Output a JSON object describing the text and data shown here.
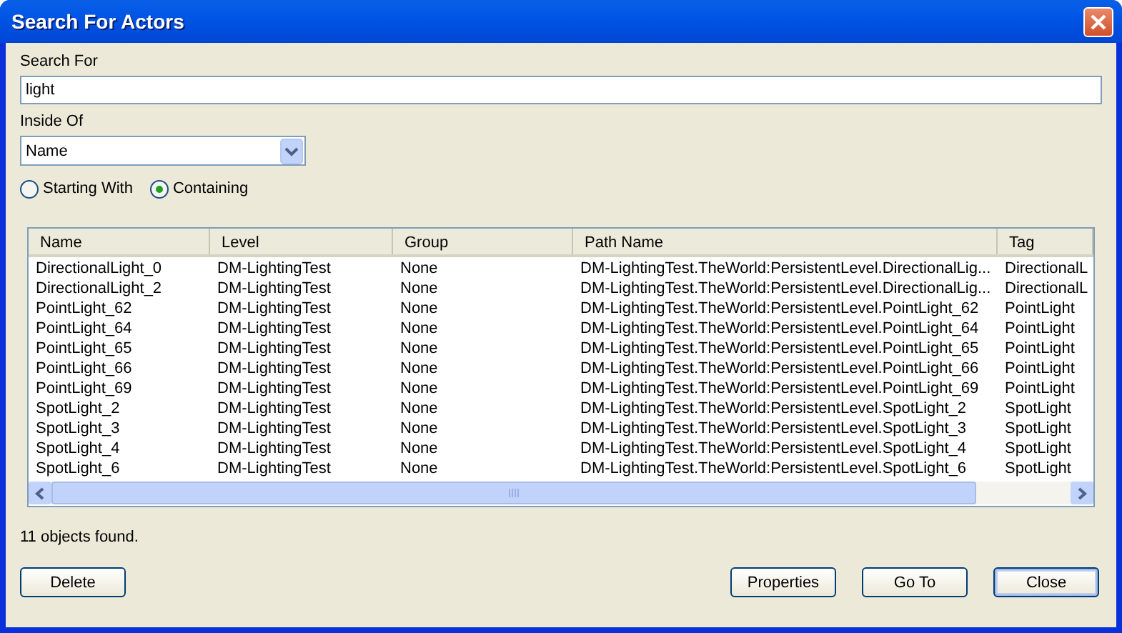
{
  "window": {
    "title": "Search For Actors"
  },
  "search_for": {
    "label": "Search For",
    "value": "light"
  },
  "inside_of": {
    "label": "Inside Of",
    "value": "Name"
  },
  "match_options": [
    {
      "label": "Starting With",
      "selected": false
    },
    {
      "label": "Containing",
      "selected": true
    }
  ],
  "table": {
    "columns": [
      "Name",
      "Level",
      "Group",
      "Path Name",
      "Tag"
    ],
    "rows": [
      [
        "DirectionalLight_0",
        "DM-LightingTest",
        "None",
        "DM-LightingTest.TheWorld:PersistentLevel.DirectionalLig...",
        "DirectionalL"
      ],
      [
        "DirectionalLight_2",
        "DM-LightingTest",
        "None",
        "DM-LightingTest.TheWorld:PersistentLevel.DirectionalLig...",
        "DirectionalL"
      ],
      [
        "PointLight_62",
        "DM-LightingTest",
        "None",
        "DM-LightingTest.TheWorld:PersistentLevel.PointLight_62",
        "PointLight"
      ],
      [
        "PointLight_64",
        "DM-LightingTest",
        "None",
        "DM-LightingTest.TheWorld:PersistentLevel.PointLight_64",
        "PointLight"
      ],
      [
        "PointLight_65",
        "DM-LightingTest",
        "None",
        "DM-LightingTest.TheWorld:PersistentLevel.PointLight_65",
        "PointLight"
      ],
      [
        "PointLight_66",
        "DM-LightingTest",
        "None",
        "DM-LightingTest.TheWorld:PersistentLevel.PointLight_66",
        "PointLight"
      ],
      [
        "PointLight_69",
        "DM-LightingTest",
        "None",
        "DM-LightingTest.TheWorld:PersistentLevel.PointLight_69",
        "PointLight"
      ],
      [
        "SpotLight_2",
        "DM-LightingTest",
        "None",
        "DM-LightingTest.TheWorld:PersistentLevel.SpotLight_2",
        "SpotLight"
      ],
      [
        "SpotLight_3",
        "DM-LightingTest",
        "None",
        "DM-LightingTest.TheWorld:PersistentLevel.SpotLight_3",
        "SpotLight"
      ],
      [
        "SpotLight_4",
        "DM-LightingTest",
        "None",
        "DM-LightingTest.TheWorld:PersistentLevel.SpotLight_4",
        "SpotLight"
      ],
      [
        "SpotLight_6",
        "DM-LightingTest",
        "None",
        "DM-LightingTest.TheWorld:PersistentLevel.SpotLight_6",
        "SpotLight"
      ]
    ]
  },
  "status": "11 objects found.",
  "left_buttons": [
    {
      "label": "Delete",
      "default": false
    }
  ],
  "right_buttons": [
    {
      "label": "Properties",
      "default": false
    },
    {
      "label": "Go To",
      "default": false
    },
    {
      "label": "Close",
      "default": true
    }
  ]
}
